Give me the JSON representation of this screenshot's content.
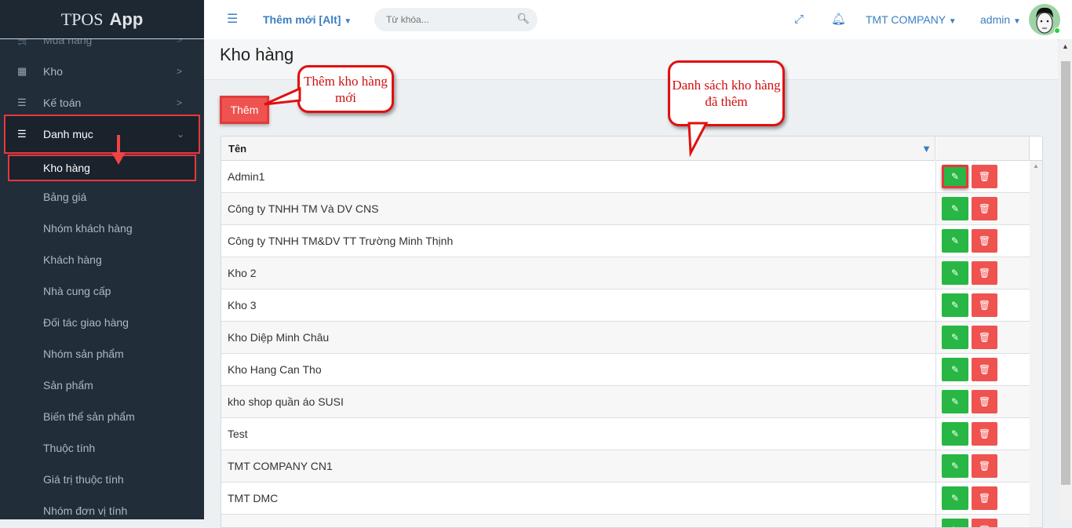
{
  "app": {
    "title_1": "TPOS",
    "title_2": "App"
  },
  "sidebar": {
    "items": [
      {
        "label": "Mua hàng",
        "icon": "cart-icon"
      },
      {
        "label": "Kho",
        "icon": "grid-icon"
      },
      {
        "label": "Kế toán",
        "icon": "list-icon"
      },
      {
        "label": "Danh mục",
        "icon": "list-icon",
        "expanded": true
      }
    ],
    "sub_items": [
      "Kho hàng",
      "Bảng giá",
      "Nhóm khách hàng",
      "Khách hàng",
      "Nhà cung cấp",
      "Đối tác giao hàng",
      "Nhóm sản phẩm",
      "Sản phẩm",
      "Biến thể sản phẩm",
      "Thuộc tính",
      "Giá trị thuộc tính",
      "Nhóm đơn vị tính"
    ],
    "active_sub": "Kho hàng"
  },
  "header": {
    "new_label": "Thêm mới [Alt]",
    "search_placeholder": "Từ khóa...",
    "company": "TMT COMPANY",
    "user": "admin"
  },
  "page": {
    "title": "Kho hàng",
    "add_button": "Thêm"
  },
  "grid": {
    "column": "Tên",
    "rows": [
      "Admin1",
      "Công ty TNHH TM Và DV CNS",
      "Công ty TNHH TM&DV TT Trường Minh Thịnh",
      "Kho 2",
      "Kho 3",
      "Kho Diệp Minh Châu",
      "Kho Hang Can Tho",
      "kho shop quần áo SUSI",
      "Test",
      "TMT COMPANY CN1",
      "TMT DMC",
      ""
    ]
  },
  "annotations": {
    "add": "Thêm kho hàng mới",
    "list": "Danh sách kho hàng đã thêm"
  },
  "colors": {
    "sidebar": "#222d3a",
    "accent": "#3b7fc4",
    "edit": "#28b744",
    "delete": "#ef5350",
    "highlight": "#e8373c"
  }
}
